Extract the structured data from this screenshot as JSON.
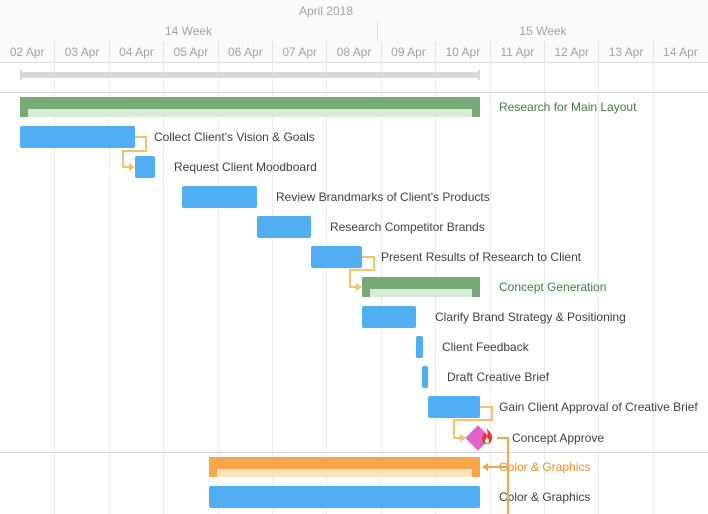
{
  "header": {
    "month": "April 2018",
    "weeks": [
      "14 Week",
      "15 Week"
    ],
    "days": [
      "02 Apr",
      "03 Apr",
      "04 Apr",
      "05 Apr",
      "06 Apr",
      "07 Apr",
      "08 Apr",
      "09 Apr",
      "10 Apr",
      "11 Apr",
      "12 Apr",
      "13 Apr",
      "14 Apr"
    ]
  },
  "tasks": [
    {
      "label": "Research for Main Layout",
      "kind": "summary"
    },
    {
      "label": "Collect Client's Vision & Goals",
      "kind": "task"
    },
    {
      "label": "Request Client Moodboard",
      "kind": "task"
    },
    {
      "label": "Review Brandmarks of Client's Products",
      "kind": "task"
    },
    {
      "label": "Research Competitor Brands",
      "kind": "task"
    },
    {
      "label": "Present Results of Research to Client",
      "kind": "task"
    },
    {
      "label": "Concept Generation",
      "kind": "summary"
    },
    {
      "label": "Clarify Brand Strategy & Positioning",
      "kind": "task"
    },
    {
      "label": "Client Feedback",
      "kind": "task"
    },
    {
      "label": "Draft Creative Brief",
      "kind": "task"
    },
    {
      "label": "Gain Client Approval of Creative Brief",
      "kind": "task"
    },
    {
      "label": "Concept Approve",
      "kind": "milestone"
    },
    {
      "label": "Color & Graphics",
      "kind": "critical-summary"
    },
    {
      "label": "Color & Graphics",
      "kind": "task"
    }
  ],
  "colors": {
    "task": "#52aef2",
    "summary": "#78aa78",
    "critical": "#f7a54a",
    "milestone": "#e264c9",
    "connector": "#f5c26a"
  },
  "icons": {
    "milestone": "diamond-icon",
    "warning": "flame-icon"
  }
}
